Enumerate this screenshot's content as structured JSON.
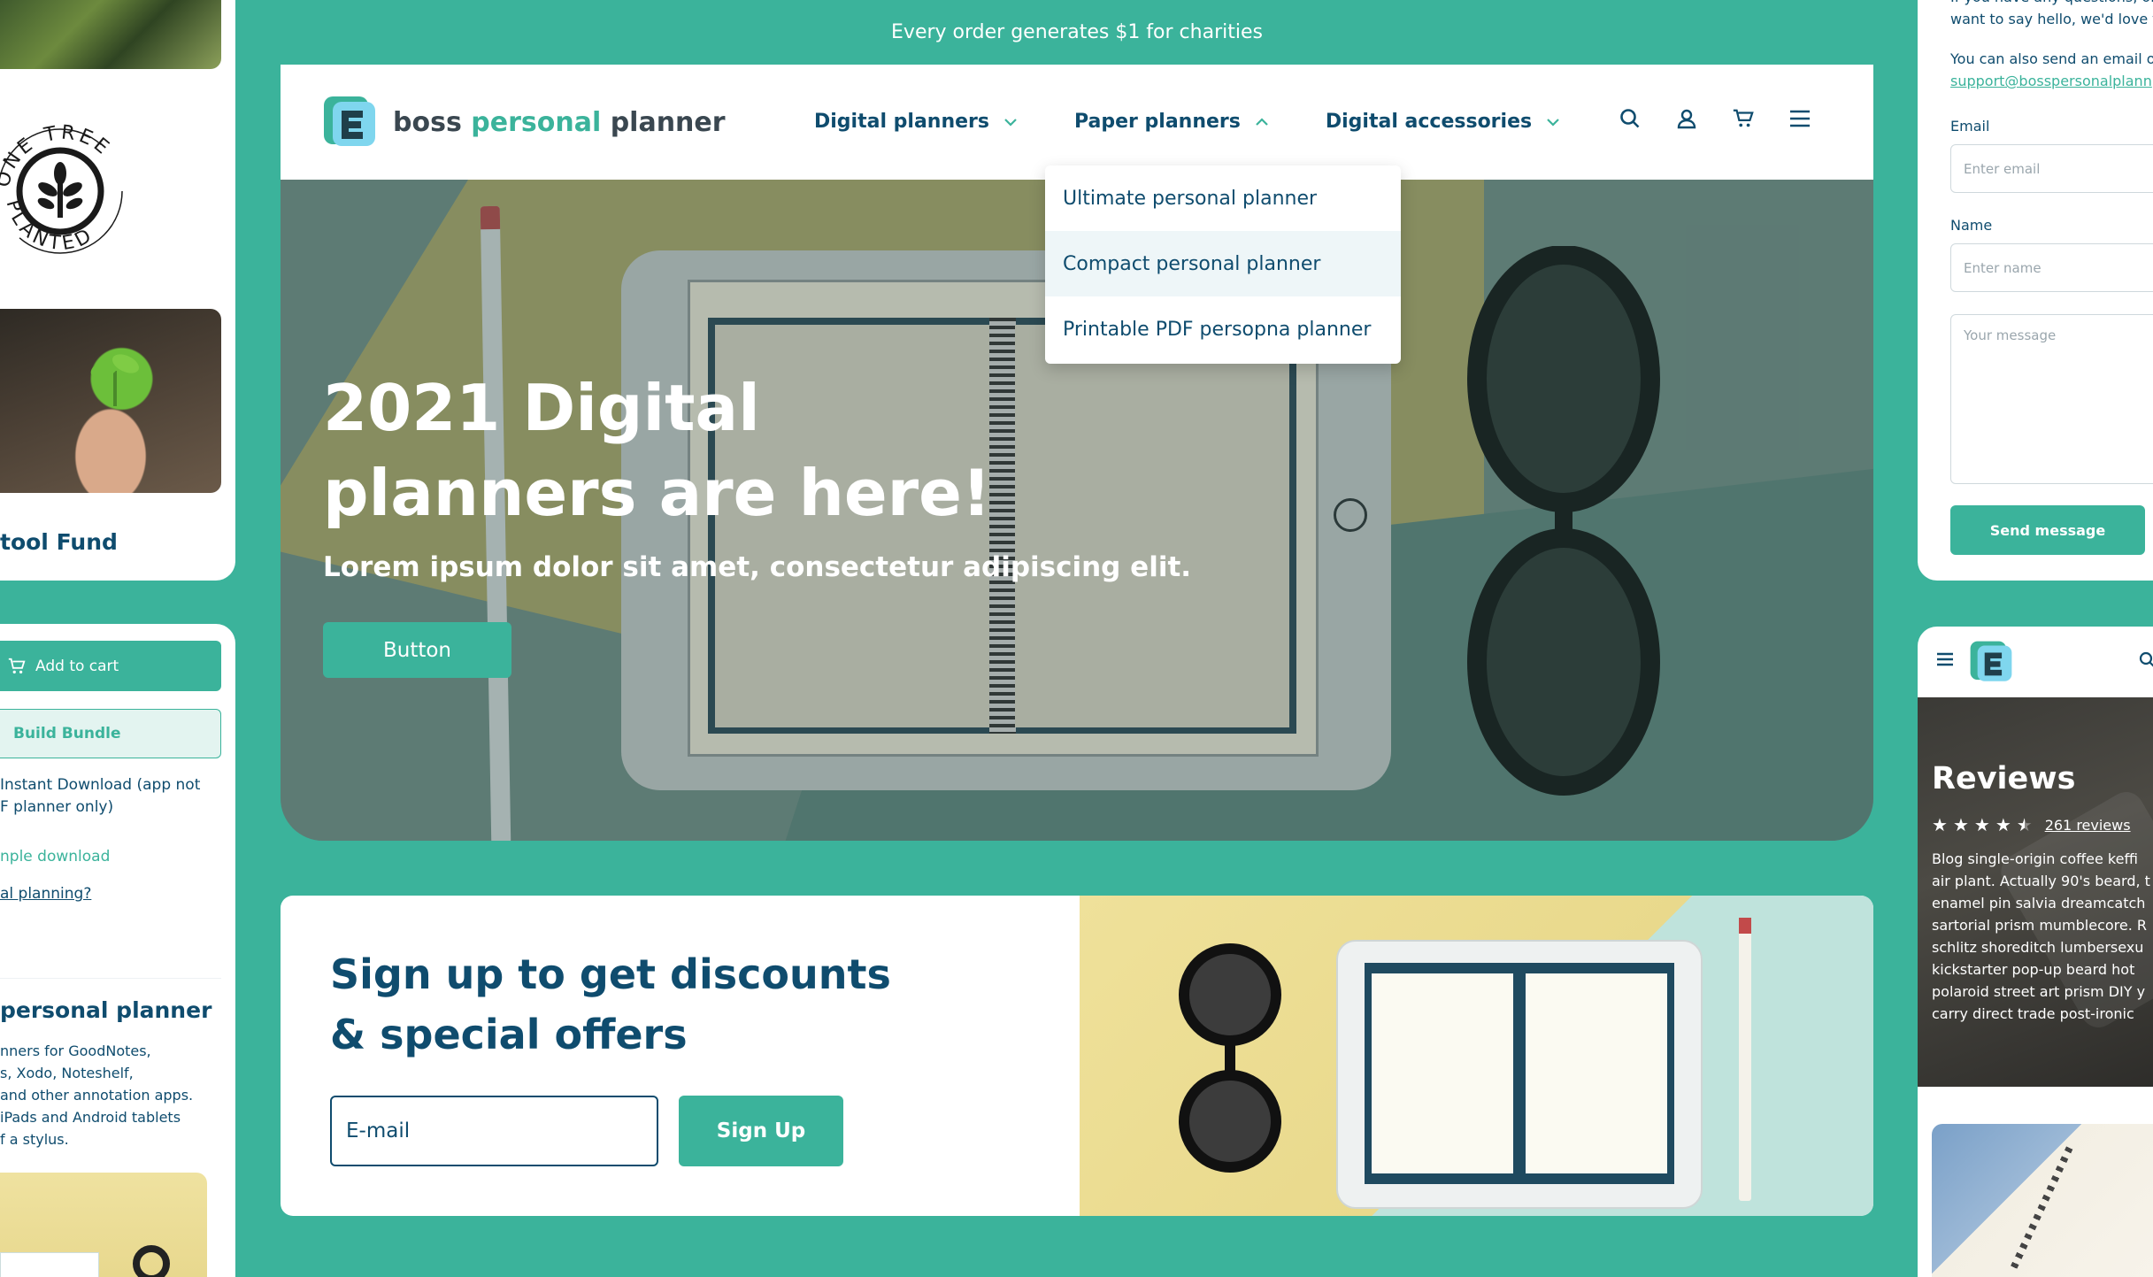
{
  "left_top": {
    "seal_top_text": "ONE TREE",
    "seal_bottom_text": "PLANTED",
    "fund_title": "tool Fund"
  },
  "left_mid": {
    "add_to_cart": "Add to cart",
    "build_bundle": "Build Bundle",
    "instant_line1": "Instant Download (app not",
    "instant_line2": "F planner only)",
    "sample_link": "nple download",
    "planning_link": "al planning?",
    "pp_title": "personal planner",
    "pp_desc_lines": [
      "nners for GoodNotes,",
      "s, Xodo, Noteshelf,",
      "and other annotation apps.",
      " iPads and Android tablets",
      "f a stylus."
    ]
  },
  "main": {
    "promo": "Every order generates $1 for charities",
    "brand": {
      "word1": "boss",
      "word2": "personal",
      "word3": "planner"
    },
    "nav": [
      {
        "label": "Digital planners",
        "chevron": "chevron-down-icon"
      },
      {
        "label": "Paper planners",
        "chevron": "chevron-up-icon"
      },
      {
        "label": "Digital accessories",
        "chevron": "chevron-down-icon"
      }
    ],
    "dropdown": [
      "Ultimate personal planner",
      "Compact personal planner",
      "Printable PDF persopna planner"
    ],
    "hero": {
      "title_line1": "2021 Digital",
      "title_line2": "planners are here!",
      "subtitle": "Lorem ipsum dolor sit amet, consectetur adipiscing elit.",
      "button": "Button"
    }
  },
  "signup": {
    "title_line1": "Sign up to get discounts",
    "title_line2": "& special offers",
    "input_placeholder": "E-mail",
    "button": "Sign Up"
  },
  "contact": {
    "intro_line1": "If you have any questions, or",
    "intro_line2": "want to say hello, we'd love t",
    "email_text": "You can also send an email o",
    "email_link": "support@bosspersonalplann",
    "email_label": "Email",
    "email_placeholder": "Enter email",
    "name_label": "Name",
    "name_placeholder": "Enter name",
    "message_placeholder": "Your message",
    "send_button": "Send message"
  },
  "reviews": {
    "title": "Reviews",
    "rating": 4.5,
    "count_link": "261 reviews",
    "text": "Blog single-origin coffee keffi\nair plant. Actually 90's beard, t\nenamel pin salvia dreamcatch\nsartorial prism mumblecore. R\nschlitz shoreditch lumbersexu\nkickstarter pop-up beard hot\npolaroid street art prism DIY y\ncarry direct trade post-ironic"
  },
  "colors": {
    "accent": "#3bb39b",
    "navy": "#0f4c6e",
    "white": "#ffffff"
  }
}
